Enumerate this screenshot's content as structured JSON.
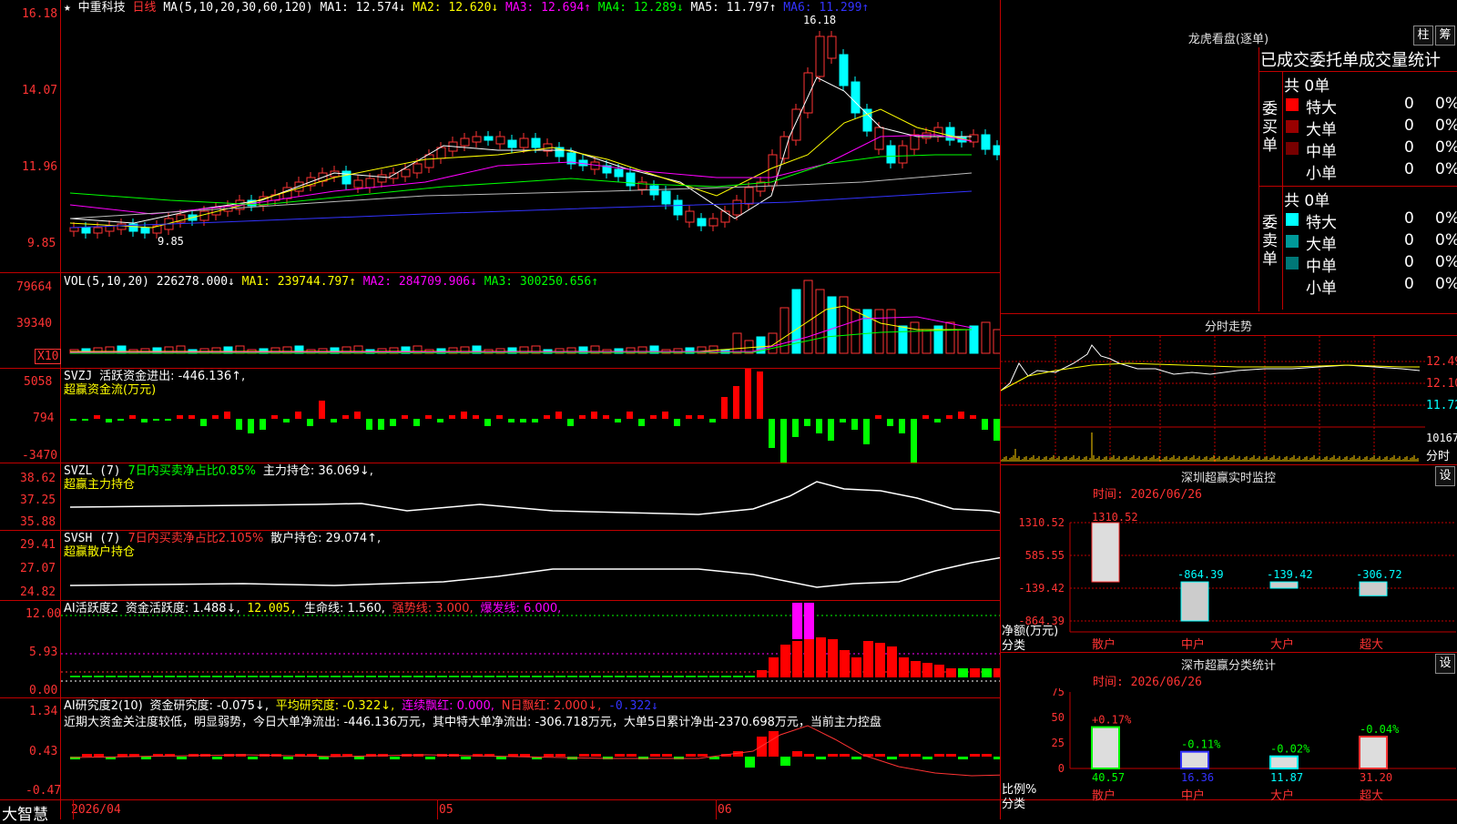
{
  "colors": {
    "red": "#ff3333",
    "cyan": "#00ffff",
    "green": "#00ff00",
    "yellow": "#ffff00",
    "magenta": "#ff00ff",
    "white": "#ffffff",
    "blue": "#3333ff",
    "grid": "#c00000"
  },
  "header": {
    "star": "★",
    "title": "中重科技",
    "period": "日线",
    "ma_label": "MA(5,10,20,30,60,120)",
    "ma1": "MA1: 12.574↓",
    "ma2": "MA2: 12.620↓",
    "ma3": "MA3: 12.694↑",
    "ma4": "MA4: 12.289↓",
    "ma5": "MA5: 11.797↑",
    "ma6": "MA6: 11.299↑"
  },
  "price_axis": [
    "16.18",
    "14.07",
    "11.96",
    "9.85"
  ],
  "price_marks": {
    "high": "16.18",
    "low": "9.85"
  },
  "vol": {
    "label": "VOL(5,10,20)",
    "value": "226278.000↓",
    "ma1": "MA1: 239744.797↑",
    "ma2": "MA2: 284709.906↓",
    "ma3": "MA3: 300250.656↑",
    "axis": [
      "79664",
      "39340"
    ],
    "unit": "X10"
  },
  "svzj": {
    "label": "SVZJ",
    "text": "活跃资金进出: -446.136↑,",
    "sub": "超赢资金流(万元)",
    "axis": [
      "5058",
      "794",
      "-3470"
    ]
  },
  "svzl": {
    "label": "SVZL (7)",
    "net": "7日内买卖净占比0.85%",
    "hold": "主力持仓: 36.069↓,",
    "sub": "超赢主力持仓",
    "axis": [
      "38.62",
      "37.25",
      "35.88"
    ]
  },
  "svsh": {
    "label": "SVSH (7)",
    "net": "7日内买卖净占比2.105%",
    "hold": "散户持仓: 29.074↑,",
    "sub": "超赢散户持仓",
    "axis": [
      "29.41",
      "27.07",
      "24.82"
    ]
  },
  "ai1": {
    "label": "AI活跃度2",
    "act": "资金活跃度: 1.488↓,",
    "v2": "12.005,",
    "life": "生命线: 1.560,",
    "strong": "强势线: 3.000,",
    "burst": "爆发线: 6.000,",
    "axis": [
      "12.00",
      "5.93",
      "0.00"
    ]
  },
  "ai2": {
    "label": "AI研究度2(10)",
    "res": "资金研究度: -0.075↓,",
    "avg": "平均研究度: -0.322↓,",
    "cont": "连续飘红: 0.000,",
    "nred": "N日飘红: 2.000↓,",
    "neg": "-0.322↓",
    "note": "近期大资金关注度较低，明显弱势，今日大单净流出: -446.136万元，其中特大单净流出: -306.718万元，大单5日累计净出-2370.698万元，当前主力控盘",
    "axis": [
      "1.34",
      "0.43",
      "-0.47"
    ]
  },
  "footer": {
    "brand": "大智慧",
    "dates": [
      "2026/04",
      "05",
      "06"
    ]
  },
  "dragon": {
    "title": "龙虎看盘(逐单)",
    "btn1": "柱",
    "btn2": "筹",
    "header": "已成交委托单成交量统计",
    "buy_title": "委买单",
    "sell_title": "委卖单",
    "buy_total": "共 0单",
    "sell_total": "共 0单",
    "buy_rows": [
      {
        "label": "特大",
        "count": "0",
        "pct": "0%",
        "color": "#ff0000"
      },
      {
        "label": "大单",
        "count": "0",
        "pct": "0%",
        "color": "#990000"
      },
      {
        "label": "中单",
        "count": "0",
        "pct": "0%",
        "color": "#770000"
      },
      {
        "label": "小单",
        "count": "0",
        "pct": "0%",
        "color": "#000000"
      }
    ],
    "sell_rows": [
      {
        "label": "特大",
        "count": "0",
        "pct": "0%",
        "color": "#00ffff"
      },
      {
        "label": "大单",
        "count": "0",
        "pct": "0%",
        "color": "#009999"
      },
      {
        "label": "中单",
        "count": "0",
        "pct": "0%",
        "color": "#007777"
      },
      {
        "label": "小单",
        "count": "0",
        "pct": "0%",
        "color": "#000000"
      }
    ]
  },
  "intraday": {
    "title": "分时走势",
    "axis": [
      "12.49",
      "12.10",
      "11.72",
      "10167"
    ],
    "unit": "分时"
  },
  "sz_monitor": {
    "title": "深圳超赢实时监控",
    "btn": "设",
    "time": "时间: 2026/06/26",
    "axis": [
      "1310.52",
      "585.55",
      "-139.42",
      "-864.39"
    ],
    "ylabel": "净额(万元)",
    "xlabel": "分类",
    "bars": [
      {
        "cat": "散户",
        "value": 1310.52,
        "label": "1310.52"
      },
      {
        "cat": "中户",
        "value": -864.39,
        "label": "-864.39"
      },
      {
        "cat": "大户",
        "value": -139.42,
        "label": "-139.42"
      },
      {
        "cat": "超大",
        "value": -306.72,
        "label": "-306.72"
      }
    ]
  },
  "sz_class": {
    "title": "深市超赢分类统计",
    "btn": "设",
    "time": "时间: 2026/06/26",
    "axis": [
      "75",
      "50",
      "25",
      "0"
    ],
    "ylabel": "比例%",
    "xlabel": "分类",
    "bars": [
      {
        "cat": "散户",
        "value": 40.57,
        "change": "+0.17%",
        "label": "40.57"
      },
      {
        "cat": "中户",
        "value": 16.36,
        "change": "-0.11%",
        "label": "16.36"
      },
      {
        "cat": "大户",
        "value": 11.87,
        "change": "-0.02%",
        "label": "11.87"
      },
      {
        "cat": "超大",
        "value": 31.2,
        "change": "-0.04%",
        "label": "31.20"
      }
    ]
  },
  "chart_data": [
    {
      "type": "bar",
      "title": "深圳超赢实时监控",
      "ylabel": "净额(万元)",
      "xlabel": "分类",
      "categories": [
        "散户",
        "中户",
        "大户",
        "超大"
      ],
      "values": [
        1310.52,
        -864.39,
        -139.42,
        -306.72
      ],
      "ylim": [
        -864.39,
        1310.52
      ]
    },
    {
      "type": "bar",
      "title": "深市超赢分类统计",
      "ylabel": "比例%",
      "xlabel": "分类",
      "categories": [
        "散户",
        "中户",
        "大户",
        "超大"
      ],
      "values": [
        40.57,
        16.36,
        11.87,
        31.2
      ],
      "ylim": [
        0,
        75
      ]
    }
  ]
}
